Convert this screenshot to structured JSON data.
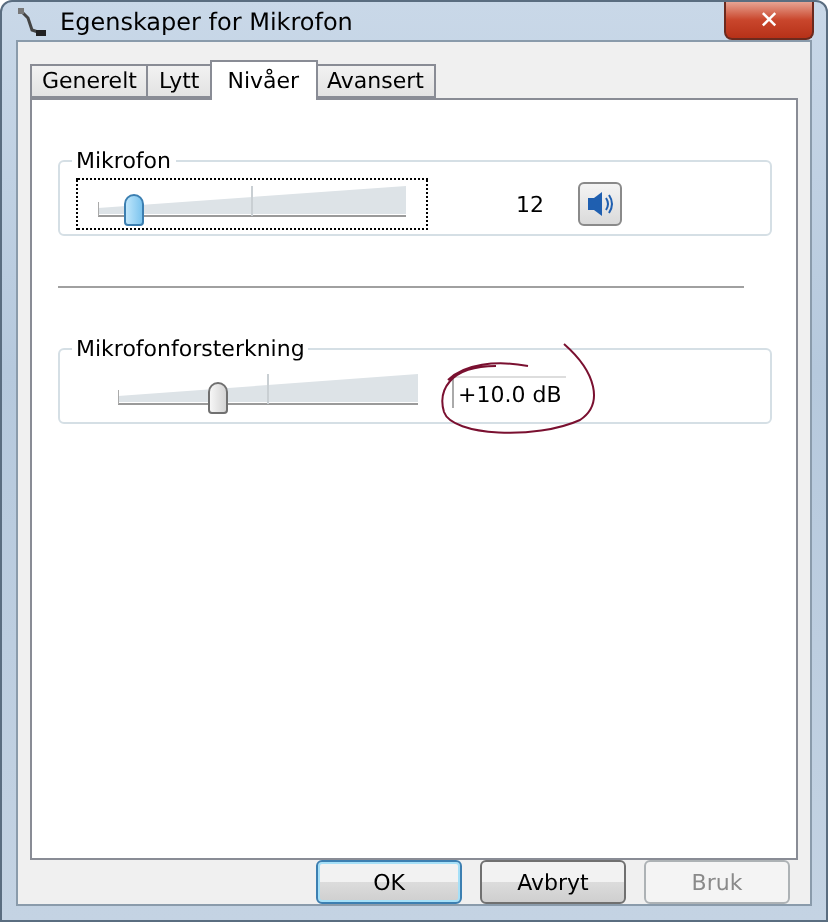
{
  "window": {
    "title": "Egenskaper for Mikrofon",
    "close": "✕"
  },
  "tabs": [
    {
      "label": "Generelt",
      "selected": false
    },
    {
      "label": "Lytt",
      "selected": false
    },
    {
      "label": "Nivåer",
      "selected": true
    },
    {
      "label": "Avansert",
      "selected": false
    }
  ],
  "groups": [
    {
      "title": "Mikrofon",
      "level": 0.12,
      "reading": "12",
      "focused": true,
      "kind": "volume",
      "muted": false
    },
    {
      "title": "Mikrofonforsterkning",
      "level": 0.33,
      "reading": "+10.0 dB",
      "focused": false,
      "kind": "boost"
    }
  ],
  "buttons": [
    {
      "label": "OK",
      "default": true,
      "disabled": false
    },
    {
      "label": "Avbryt",
      "default": false,
      "disabled": false
    },
    {
      "label": "Bruk",
      "default": false,
      "disabled": true
    }
  ]
}
